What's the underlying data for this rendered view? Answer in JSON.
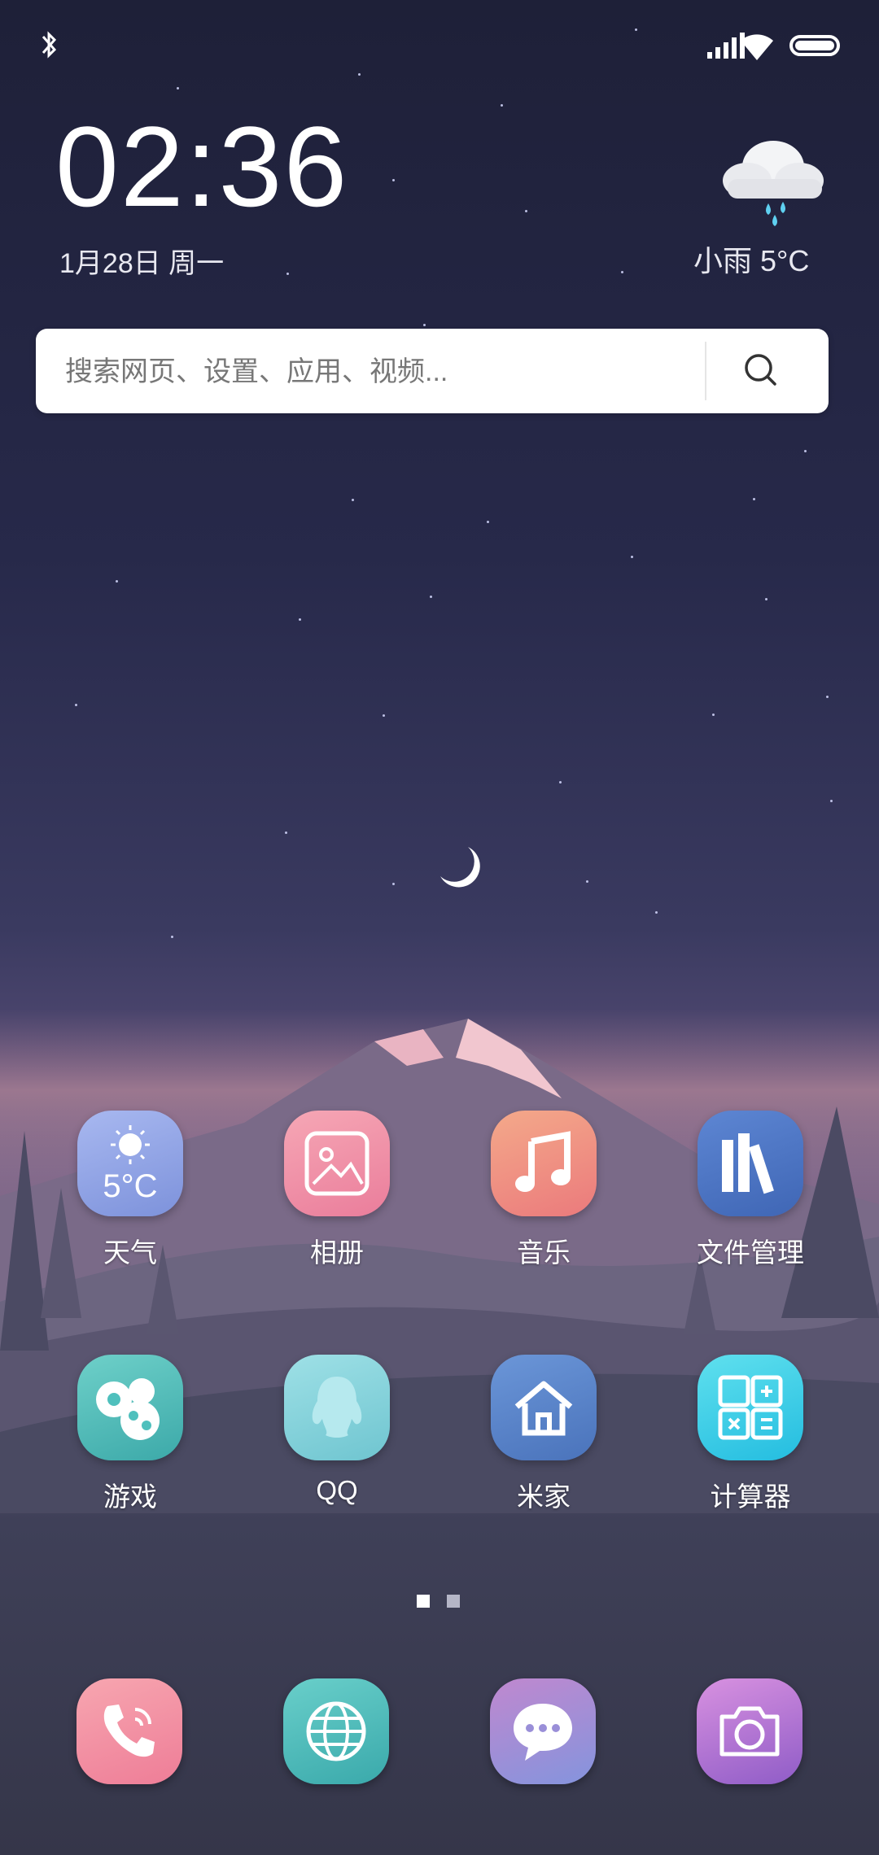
{
  "status_bar": {
    "icons": [
      "bluetooth-icon",
      "signal-icon",
      "wifi-icon",
      "battery-icon"
    ]
  },
  "clock": {
    "time": "02:36",
    "date": "1月28日 周一"
  },
  "weather_widget": {
    "icon": "rain-cloud-icon",
    "text": "小雨   5°C"
  },
  "search": {
    "placeholder": "搜索网页、设置、应用、视频...",
    "icon": "search-icon"
  },
  "apps": [
    {
      "label": "天气",
      "icon": "weather-icon",
      "badge_text": "5°C",
      "color": "#8da3e6"
    },
    {
      "label": "相册",
      "icon": "gallery-icon",
      "color": "#f08ca4"
    },
    {
      "label": "音乐",
      "icon": "music-icon",
      "color": "#f0907a"
    },
    {
      "label": "文件管理",
      "icon": "file-manager-icon",
      "color": "#4f78c8"
    },
    {
      "label": "游戏",
      "icon": "games-icon",
      "color": "#4fc0bd"
    },
    {
      "label": "QQ",
      "icon": "qq-icon",
      "color": "#86d3dc"
    },
    {
      "label": "米家",
      "icon": "mi-home-icon",
      "color": "#5b86cc"
    },
    {
      "label": "计算器",
      "icon": "calculator-icon",
      "color": "#3fd2e6"
    }
  ],
  "pager": {
    "pages": 2,
    "current": 1
  },
  "dock": [
    {
      "icon": "phone-icon",
      "color": "#f28ca0"
    },
    {
      "icon": "browser-icon",
      "color": "#52bdbb"
    },
    {
      "icon": "messages-icon",
      "color": "#9a8fd8"
    },
    {
      "icon": "camera-icon",
      "color": "#b06ed0"
    }
  ]
}
